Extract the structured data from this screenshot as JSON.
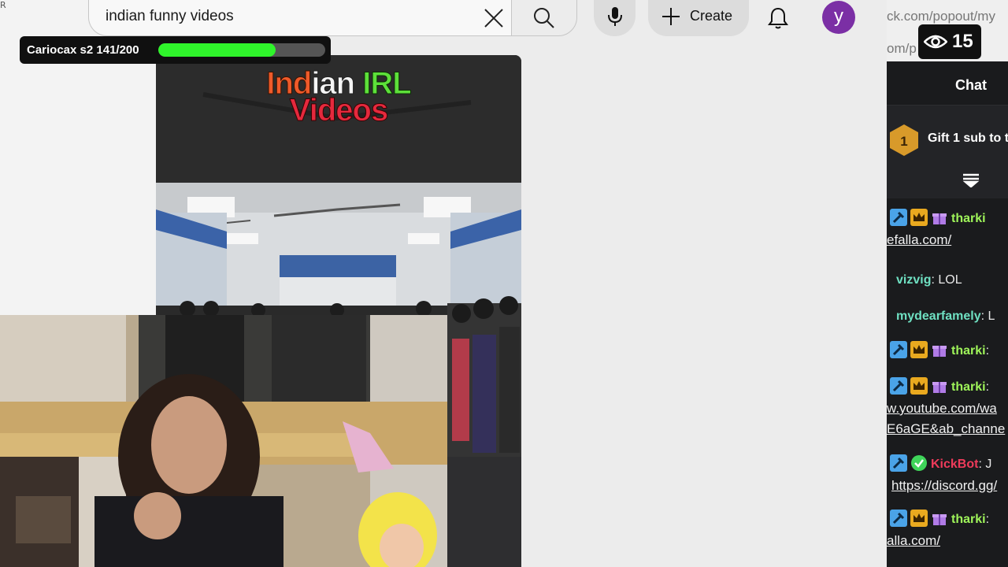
{
  "corner_glyph": "R",
  "search": {
    "value": "indian funny videos",
    "clear_icon": "close-icon",
    "search_icon": "search-icon"
  },
  "toolbar": {
    "mic_icon": "microphone-icon",
    "create_label": "Create",
    "bell_icon": "bell-icon",
    "avatar_letter": "y",
    "avatar_color": "#7b2fa5"
  },
  "progress": {
    "label": "Cariocax s2 141/200",
    "current": 141,
    "total": 200,
    "fill_color": "#2ff52b"
  },
  "video": {
    "title_words": [
      "Ind",
      "ian",
      "IRL"
    ],
    "title_line2": "Videos"
  },
  "browser": {
    "url_line1": "ck.com/popout/my",
    "url_line2": "om/p      afro"
  },
  "viewers": {
    "count": "15",
    "icon": "eye-icon"
  },
  "chat": {
    "title": "Chat",
    "gift_badge_number": "1",
    "gift_text": "Gift 1 sub to t",
    "messages": [
      {
        "user": "tharki",
        "text": "",
        "color": "green",
        "badges": [
          "mod",
          "crown",
          "gift"
        ],
        "link": "efalla.com/"
      },
      {
        "user": "vizvig",
        "text": ": LOL",
        "color": "teal",
        "badges": [],
        "link": ""
      },
      {
        "user": "mydearfamely",
        "text": ": L",
        "color": "teal",
        "badges": [],
        "link": ""
      },
      {
        "user": "tharki",
        "text": ":",
        "color": "green",
        "badges": [
          "mod",
          "crown",
          "gift"
        ],
        "link": ""
      },
      {
        "user": "tharki",
        "text": ":",
        "color": "green",
        "badges": [
          "mod",
          "crown",
          "gift"
        ],
        "link": "w.youtube.com/wa",
        "link2": "E6aGE&ab_channe"
      },
      {
        "user": "KickBot",
        "text": ": J",
        "color": "red",
        "badges": [
          "mod",
          "verify"
        ],
        "link": "https://discord.gg/"
      },
      {
        "user": "tharki",
        "text": ":",
        "color": "green",
        "badges": [
          "mod",
          "crown",
          "gift"
        ],
        "link": "alla.com/"
      }
    ]
  }
}
